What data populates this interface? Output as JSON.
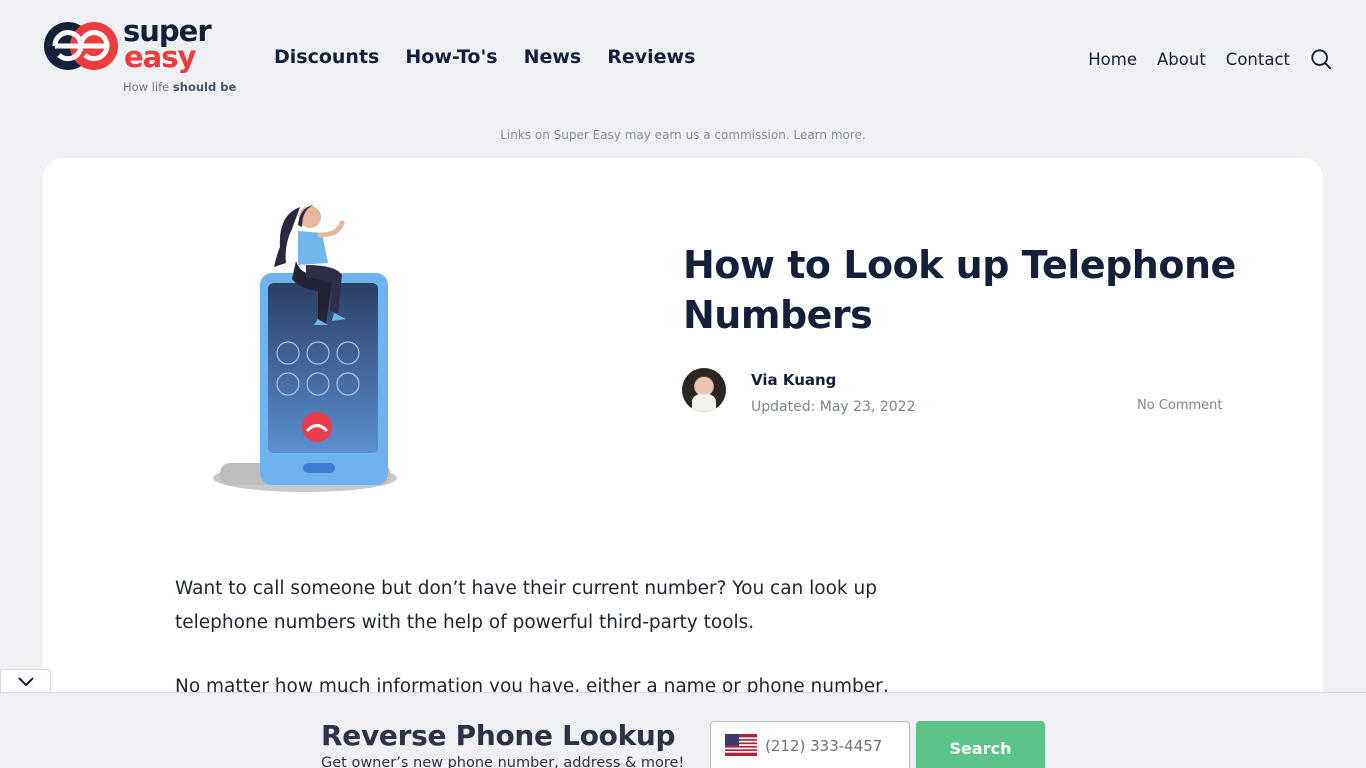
{
  "brand": {
    "name_line1": "super",
    "name_line2": "easy",
    "tagline_prefix": "How life ",
    "tagline_bold": "should be",
    "colors": {
      "navy": "#14203a",
      "red": "#ee3b3b"
    }
  },
  "main_nav": [
    "Discounts",
    "How-To's",
    "News",
    "Reviews"
  ],
  "secondary_nav": [
    "Home",
    "About",
    "Contact"
  ],
  "search_icon": "search-icon",
  "disclaimer": "Links on Super Easy may earn us a commission. Learn more.",
  "article": {
    "title": "How to Look up Telephone Numbers",
    "author": "Via Kuang",
    "updated": "Updated: May 23, 2022",
    "comments": "No Comment",
    "paragraphs": [
      "Want to call someone but don’t have their current number? You can look up telephone numbers with the help of powerful third-party tools.",
      "No matter how much information you have, either a name or phone number,"
    ]
  },
  "lookup": {
    "title": "Reverse Phone Lookup",
    "subtitle": "Get owner’s new phone number, address & more!",
    "placeholder": "(212) 333-4457",
    "button": "Search",
    "flag_icon": "us-flag-icon",
    "button_color": "#5cc48a"
  }
}
